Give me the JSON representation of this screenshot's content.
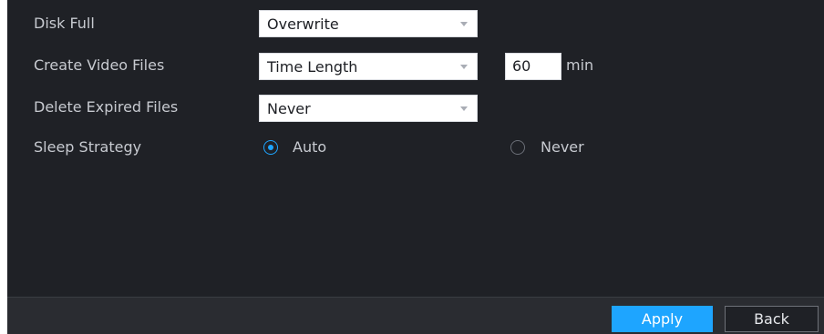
{
  "settings": {
    "disk_full": {
      "label": "Disk Full",
      "value": "Overwrite"
    },
    "create_video_files": {
      "label": "Create Video Files",
      "value": "Time Length",
      "length_value": "60",
      "length_unit": "min"
    },
    "delete_expired_files": {
      "label": "Delete Expired Files",
      "value": "Never"
    },
    "sleep_strategy": {
      "label": "Sleep Strategy",
      "options": [
        {
          "label": "Auto",
          "selected": true
        },
        {
          "label": "Never",
          "selected": false
        }
      ]
    }
  },
  "footer": {
    "apply_label": "Apply",
    "back_label": "Back"
  },
  "colors": {
    "accent": "#1ea5ff",
    "panel_background": "#1f2126",
    "label_text": "#c7cad0"
  },
  "icons": {
    "dropdown_caret": "chevron-down-icon",
    "radio_selected": "radio-checked-icon",
    "radio_unselected": "radio-unchecked-icon"
  }
}
